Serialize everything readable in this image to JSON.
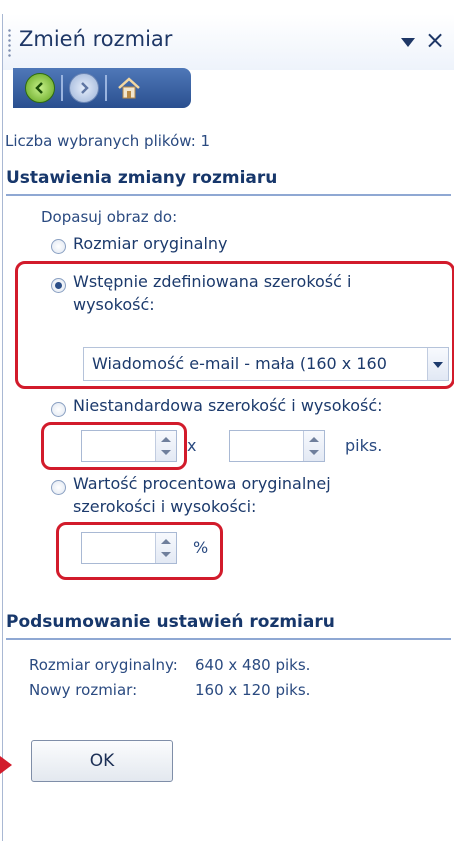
{
  "panel": {
    "title": "Zmień rozmiar",
    "close_label": "×"
  },
  "nav": {
    "back": "back",
    "forward": "forward",
    "home": "home"
  },
  "selected_files_text": "Liczba wybranych plików: 1",
  "settings": {
    "heading": "Ustawienia zmiany rozmiaru",
    "fit_label": "Dopasuj obraz do:",
    "options": [
      {
        "label": "Rozmiar oryginalny",
        "checked": false
      },
      {
        "label_line1": "Wstępnie zdefiniowana szerokość i",
        "label_line2": "wysokość:",
        "checked": true
      },
      {
        "label": "Niestandardowa szerokość i wysokość:",
        "checked": false
      },
      {
        "label_line1": "Wartość procentowa oryginalnej",
        "label_line2": "szerokości i wysokości:",
        "checked": false
      }
    ],
    "preset_value": "Wiadomość e-mail - mała (160 x 160",
    "custom_sep": "x",
    "custom_unit": "piks.",
    "width_value": "",
    "height_value": "",
    "percent_value": "",
    "percent_unit": "%"
  },
  "summary": {
    "heading": "Podsumowanie ustawień rozmiaru",
    "rows": [
      {
        "label": "Rozmiar oryginalny:",
        "value": "640 x 480 piks."
      },
      {
        "label": "Nowy rozmiar:",
        "value": "160 x 120 piks."
      }
    ]
  },
  "ok_label": "OK",
  "colors": {
    "highlight": "#d21b2b",
    "nav_bar": "#2a4f8f",
    "text": "#1c3a6c"
  }
}
